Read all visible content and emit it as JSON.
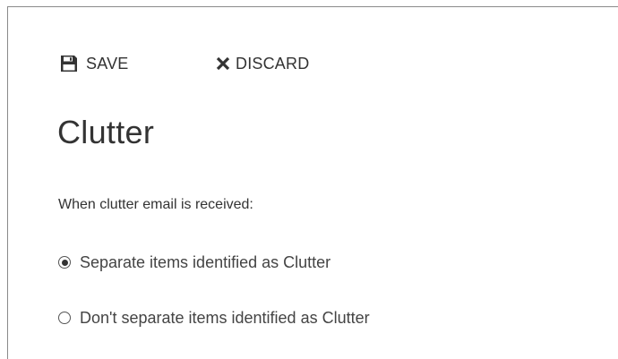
{
  "toolbar": {
    "save_label": "SAVE",
    "save_icon": "floppy-disk-icon",
    "discard_label": "DISCARD",
    "discard_icon": "close-x-icon"
  },
  "page": {
    "title": "Clutter"
  },
  "clutter_setting": {
    "prompt": "When clutter email is received:",
    "options": [
      {
        "label": "Separate items identified as Clutter",
        "selected": true
      },
      {
        "label": "Don't separate items identified as Clutter",
        "selected": false
      }
    ]
  },
  "colors": {
    "text": "#333333",
    "border": "#8a8a8a",
    "background": "#ffffff"
  }
}
